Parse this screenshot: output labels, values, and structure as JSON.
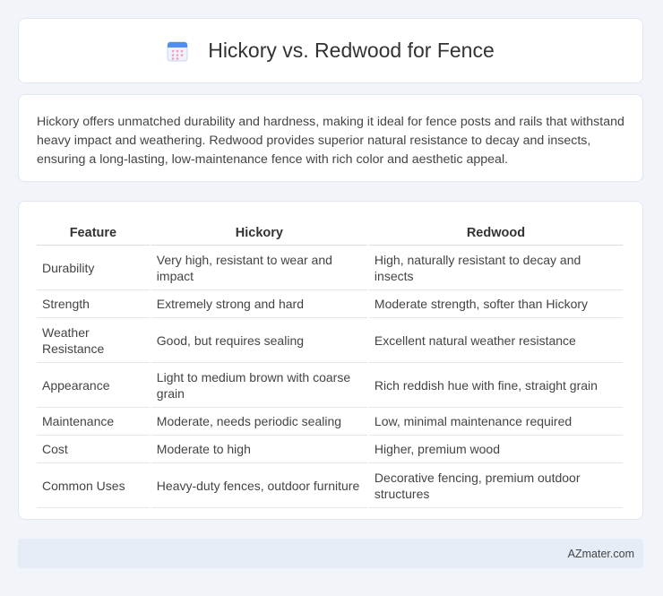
{
  "header": {
    "title": "Hickory vs. Redwood for Fence",
    "icon": "calendar-icon"
  },
  "intro": {
    "text": "Hickory offers unmatched durability and hardness, making it ideal for fence posts and rails that withstand heavy impact and weathering. Redwood provides superior natural resistance to decay and insects, ensuring a long-lasting, low-maintenance fence with rich color and aesthetic appeal."
  },
  "table": {
    "headers": [
      "Feature",
      "Hickory",
      "Redwood"
    ],
    "rows": [
      [
        "Durability",
        "Very high, resistant to wear and impact",
        "High, naturally resistant to decay and insects"
      ],
      [
        "Strength",
        "Extremely strong and hard",
        "Moderate strength, softer than Hickory"
      ],
      [
        "Weather Resistance",
        "Good, but requires sealing",
        "Excellent natural weather resistance"
      ],
      [
        "Appearance",
        "Light to medium brown with coarse grain",
        "Rich reddish hue with fine, straight grain"
      ],
      [
        "Maintenance",
        "Moderate, needs periodic sealing",
        "Low, minimal maintenance required"
      ],
      [
        "Cost",
        "Moderate to high",
        "Higher, premium wood"
      ],
      [
        "Common Uses",
        "Heavy-duty fences, outdoor furniture",
        "Decorative fencing, premium outdoor structures"
      ]
    ]
  },
  "footer": {
    "text": "AZmater.com"
  },
  "colors": {
    "background": "#f1f4f9",
    "footer_bg": "#e6ecf6",
    "icon_blue": "#4f8fe8",
    "icon_pink": "#f29bb8"
  }
}
